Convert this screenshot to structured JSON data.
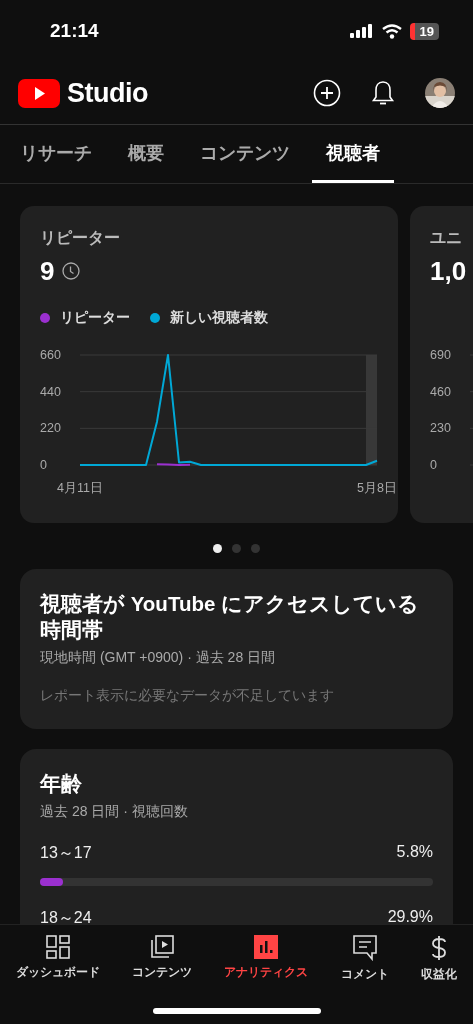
{
  "status_bar": {
    "time": "21:14",
    "battery": "19"
  },
  "header": {
    "logo_text": "Studio"
  },
  "tabs": [
    {
      "label": "リサーチ",
      "selected": false
    },
    {
      "label": "概要",
      "selected": false
    },
    {
      "label": "コンテンツ",
      "selected": false
    },
    {
      "label": "視聴者",
      "selected": true
    }
  ],
  "metric_cards": [
    {
      "title": "リピーター",
      "value": "9",
      "chart_data": {
        "type": "line",
        "categories": [
          "4月11日",
          null,
          null,
          null,
          null,
          null,
          null,
          null,
          null,
          null,
          null,
          null,
          null,
          null,
          null,
          null,
          null,
          null,
          null,
          null,
          null,
          null,
          null,
          null,
          null,
          null,
          null,
          "5月8日"
        ],
        "ylim": [
          0,
          660
        ],
        "yticks": [
          0,
          220,
          440,
          660
        ],
        "series": [
          {
            "name": "リピーター",
            "color": "#9b30d0",
            "values": [
              null,
              null,
              null,
              null,
              null,
              null,
              null,
              5,
              3,
              0,
              2,
              null,
              null,
              null,
              null,
              null,
              null,
              null,
              null,
              null,
              null,
              null,
              null,
              null,
              null,
              null,
              null,
              null
            ]
          },
          {
            "name": "新しい視聴者数",
            "color": "#00a8d6",
            "values": [
              0,
              0,
              0,
              0,
              0,
              0,
              0,
              260,
              660,
              15,
              20,
              0,
              0,
              0,
              0,
              0,
              0,
              0,
              0,
              0,
              0,
              0,
              0,
              0,
              0,
              0,
              0,
              25
            ]
          }
        ]
      }
    },
    {
      "title": "ユニ",
      "value": "1,0",
      "axis_labels": [
        "690",
        "460",
        "230",
        "0"
      ]
    }
  ],
  "carousel": {
    "pages": [
      {
        "selected": true
      },
      {
        "selected": false
      },
      {
        "selected": false
      }
    ]
  },
  "time_card": {
    "title": "視聴者が YouTube にアクセスしている時間帯",
    "subtitle": "現地時間 (GMT +0900) · 過去 28 日間",
    "message": "レポート表示に必要なデータが不足しています"
  },
  "age_card": {
    "title": "年齢",
    "subtitle": "過去 28 日間 · 視聴回数",
    "rows": [
      {
        "range": "13～17",
        "percent": "5.8%",
        "level": 0.058
      },
      {
        "range": "18～24",
        "percent": "29.9%"
      }
    ]
  },
  "bottom_nav": [
    {
      "kind": "dashboard",
      "label": "ダッシュボード",
      "selected": false
    },
    {
      "kind": "content",
      "label": "コンテンツ",
      "selected": false
    },
    {
      "kind": "analytics",
      "label": "アナリティクス",
      "selected": true
    },
    {
      "kind": "comments",
      "label": "コメント",
      "selected": false
    },
    {
      "kind": "earn",
      "label": "収益化",
      "selected": false
    }
  ]
}
